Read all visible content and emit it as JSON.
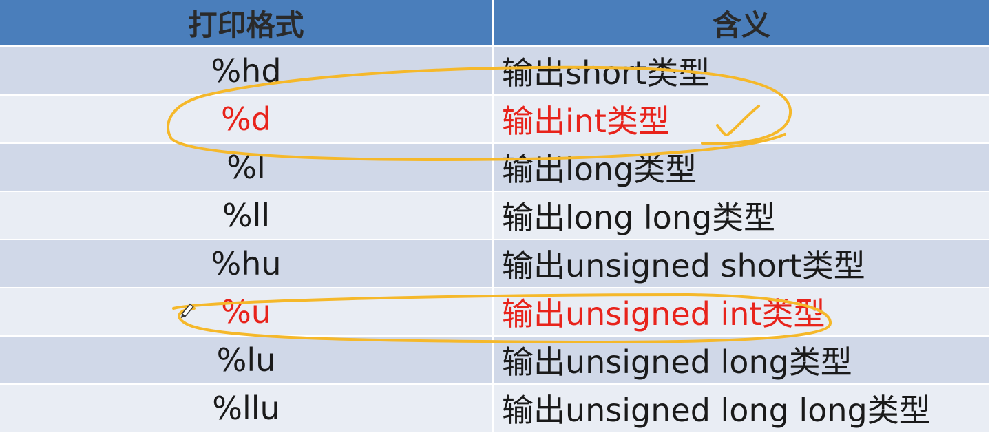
{
  "table": {
    "headers": [
      "打印格式",
      "含义"
    ],
    "rows": [
      {
        "format": "%hd",
        "meaning": "输出short类型",
        "highlight": false
      },
      {
        "format": "%d",
        "meaning": "输出int类型",
        "highlight": true
      },
      {
        "format": "%l",
        "meaning": "输出long类型",
        "highlight": false
      },
      {
        "format": "%ll",
        "meaning": "输出long long类型",
        "highlight": false
      },
      {
        "format": "%hu",
        "meaning": "输出unsigned short类型",
        "highlight": false
      },
      {
        "format": "%u",
        "meaning": "输出unsigned int类型",
        "highlight": true
      },
      {
        "format": "%lu",
        "meaning": "输出unsigned long类型",
        "highlight": false
      },
      {
        "format": "%llu",
        "meaning": "输出unsigned long long类型",
        "highlight": false
      }
    ]
  },
  "colors": {
    "header_bg": "#4a7ebb",
    "row_odd": "#d0d8e8",
    "row_even": "#e9edf4",
    "highlight_text": "#e8231b",
    "annotation_stroke": "#f5b82a"
  },
  "annotations": {
    "icons": [
      "pen-cursor-icon",
      "checkmark-icon"
    ]
  }
}
